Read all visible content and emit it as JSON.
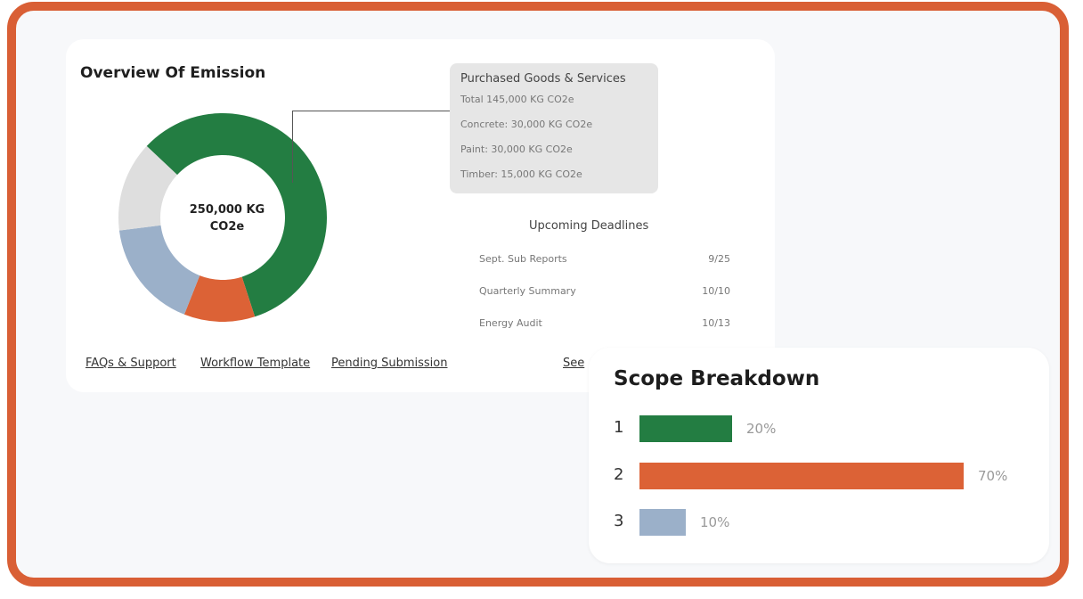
{
  "overview": {
    "title": "Overview Of Emission",
    "total_line1": "250,000 KG",
    "total_line2": "CO2e",
    "donut_segments": [
      {
        "name": "Purchased Goods & Services",
        "share": 0.58,
        "color": "#237d42"
      },
      {
        "name": "segment-orange",
        "share": 0.11,
        "color": "#dc6236"
      },
      {
        "name": "segment-blue",
        "share": 0.17,
        "color": "#9bb0c9"
      },
      {
        "name": "segment-grey",
        "share": 0.14,
        "color": "#dedede"
      }
    ]
  },
  "tooltip": {
    "title": "Purchased Goods & Services",
    "lines": [
      "Total 145,000 KG CO2e",
      "Concrete: 30,000 KG CO2e",
      "Paint: 30,000 KG CO2e",
      "Timber: 15,000 KG CO2e"
    ]
  },
  "deadlines": {
    "title": "Upcoming Deadlines",
    "items": [
      {
        "label": "Sept. Sub Reports",
        "date": "9/25"
      },
      {
        "label": "Quarterly Summary",
        "date": "10/10"
      },
      {
        "label": "Energy Audit",
        "date": "10/13"
      }
    ]
  },
  "footer_links": [
    "FAQs & Support",
    "Workflow Template",
    "Pending Submission",
    "See"
  ],
  "scope": {
    "title": "Scope Breakdown",
    "items": [
      {
        "label": "1",
        "value": 20,
        "value_label": "20%",
        "color": "#237d42"
      },
      {
        "label": "2",
        "value": 70,
        "value_label": "70%",
        "color": "#dc6236"
      },
      {
        "label": "3",
        "value": 10,
        "value_label": "10%",
        "color": "#9bb0c9"
      }
    ]
  },
  "theme": {
    "frame": "#d95f35",
    "background": "#f7f8fa"
  }
}
